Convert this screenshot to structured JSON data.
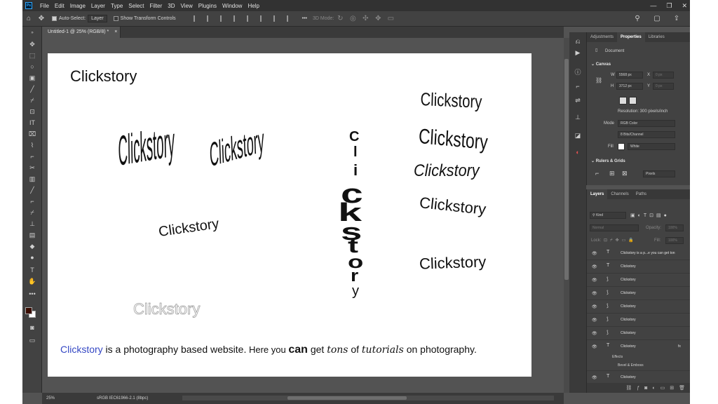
{
  "app": {
    "logo": "Ps",
    "window_controls": [
      "—",
      "❐",
      "✕"
    ]
  },
  "menu": [
    "File",
    "Edit",
    "Image",
    "Layer",
    "Type",
    "Select",
    "Filter",
    "3D",
    "View",
    "Plugins",
    "Window",
    "Help"
  ],
  "options": {
    "auto_select_label": "Auto-Select:",
    "auto_select_value": "Layer",
    "show_transform": "Show Transform Controls",
    "mode_3d": "3D Mode:",
    "more": "•••"
  },
  "tab": {
    "title": "Untitled-1 @ 25% (RGB/8) *",
    "close": "×"
  },
  "canvas": {
    "title_text": "Clickstory",
    "warp_bulge": "Clickstory",
    "warp_flag": "Clickstory",
    "arc_text": "Clickstory",
    "outline_text": "Clickstory",
    "vertical_letters": [
      "C",
      "l",
      "i",
      "c",
      "k",
      "s",
      "t",
      "o",
      "r",
      "y"
    ],
    "right_texts": [
      "Clickstory",
      "Clickstory",
      "Clickstory",
      "Clickstory",
      "Clickstory"
    ],
    "sentence": {
      "brand": "Clickstory",
      "p1": " is a photography based website.",
      "here": " Here you ",
      "can": "can",
      "get": " get ",
      "tons": "tons",
      "of": " of ",
      "tutorials": "tutorials",
      "end": " on photography."
    }
  },
  "status": {
    "zoom": "25%",
    "profile": "sRGB IEC61966-2.1 (8bpc)"
  },
  "properties": {
    "tabs": [
      "Adjustments",
      "Properties",
      "Libraries"
    ],
    "doc_label": "Document",
    "canvas_header": "Canvas",
    "w_label": "W",
    "w_value": "5568 px",
    "x_label": "X",
    "x_value": "0 px",
    "h_label": "H",
    "h_value": "3712 px",
    "y_label": "Y",
    "y_value": "0 px",
    "resolution": "Resolution: 300 pixels/inch",
    "mode_label": "Mode",
    "mode_value": "RGB Color",
    "bits_value": "8 Bits/Channel",
    "fill_label": "Fill",
    "fill_value": "White",
    "rulers_header": "Rulers & Grids",
    "units_value": "Pixels"
  },
  "layers": {
    "tabs": [
      "Layers",
      "Channels",
      "Paths"
    ],
    "filter": "Kind",
    "blend": "Normal",
    "opacity_label": "Opacity:",
    "opacity": "100%",
    "lock_label": "Lock:",
    "fill_label": "Fill:",
    "fill": "100%",
    "rows": [
      {
        "icon": "T",
        "name": "Clickstory is a p...e you can get ton"
      },
      {
        "icon": "T",
        "name": "Clickstory"
      },
      {
        "icon": "⟆",
        "name": "Clickstory"
      },
      {
        "icon": "⟆",
        "name": "Clickstory"
      },
      {
        "icon": "⟆",
        "name": "Clickstory"
      },
      {
        "icon": "⟆",
        "name": "Clickstory"
      },
      {
        "icon": "⟆",
        "name": "Clickstory"
      },
      {
        "icon": "T",
        "name": "Clickstory"
      }
    ],
    "effects": "Effects",
    "bevel": "Bevel & Emboss",
    "last_row": {
      "icon": "T",
      "name": "Clickstory"
    },
    "fx": "fx"
  }
}
